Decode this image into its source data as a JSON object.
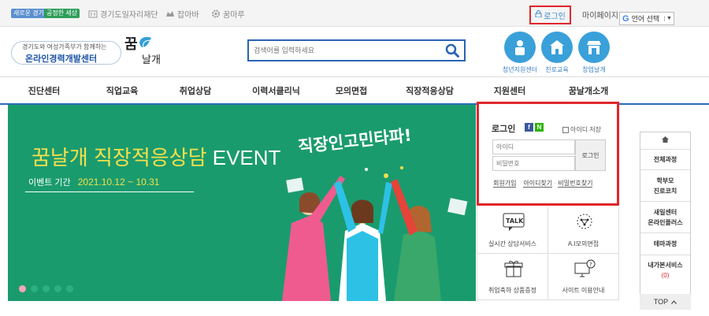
{
  "topbar": {
    "badges": [
      "새로운 경기",
      "공정한 세상"
    ],
    "links": [
      "경기도일자리재단",
      "잡아바",
      "꿈마루"
    ],
    "login": "로그인",
    "mypage": "마이페이지",
    "translate": "언어 선택"
  },
  "header": {
    "tagline": "경기도와 여성가족부가 함께하는",
    "center_name": "온라인경력개발센터",
    "logo_text": "꿈날개",
    "search_placeholder": "검색어를 입력하세요",
    "quick_links": [
      "청년지원센터",
      "진로교육",
      "창업날개"
    ]
  },
  "nav": [
    "진단센터",
    "직업교육",
    "취업상담",
    "이력서클리닉",
    "모의면접",
    "직장적응상담",
    "지원센터",
    "꿈날개소개"
  ],
  "banner": {
    "title_part1": "꿈날개 직장적응상담",
    "title_part2": "EVENT",
    "period_label": "이벤트 기간",
    "period": "2021.10.12 ~ 10.31",
    "headline": "직장인고민타파!"
  },
  "login_box": {
    "title": "로그인",
    "sns": [
      "f",
      "N"
    ],
    "save_id": "아이디 저장",
    "id_placeholder": "아이디",
    "pw_placeholder": "비밀번호",
    "login_button": "로그인",
    "links": [
      "회원가입",
      "아이디찾기",
      "비밀번호찾기"
    ]
  },
  "services": [
    {
      "label": "실시간 상담서비스",
      "icon": "talk-bubble-icon",
      "icon_text": "TALK"
    },
    {
      "label": "A.I모의면접",
      "icon": "ai-brain-icon"
    },
    {
      "label": "취업축하 상품증정",
      "icon": "gift-icon"
    },
    {
      "label": "사이트 이용안내",
      "icon": "help-monitor-icon"
    }
  ],
  "quick_panel": {
    "items": [
      "전체과정",
      "학부모",
      "진로코치",
      "새일센터",
      "온라인플러스",
      "테마과정",
      "내가본서비스"
    ],
    "count": "(0)",
    "top": "TOP"
  },
  "colors": {
    "accent": "#2d6bb5",
    "banner": "#1a9b6e",
    "highlight": "#e0262b"
  }
}
